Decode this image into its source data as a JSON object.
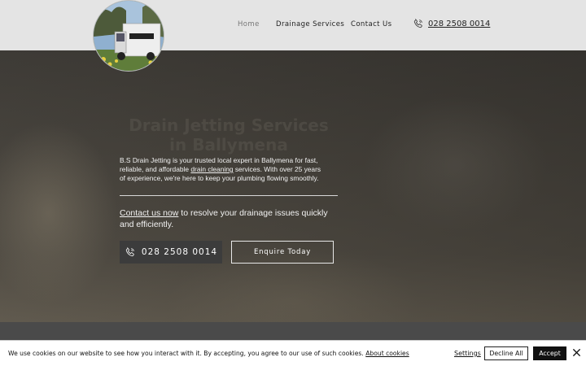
{
  "header": {
    "logo_alt": "B.S Drain Jetting van",
    "nav": [
      {
        "label": "Home",
        "active": true
      },
      {
        "label": "Drainage Services",
        "active": false
      },
      {
        "label": "Contact Us",
        "active": false
      }
    ],
    "phone": "028 2508 0014",
    "phone_icon": "phone-icon"
  },
  "hero": {
    "title": "Drain Jetting Services\nin Ballymena",
    "description_before": "B.S Drain Jetting is your trusted local expert in Ballymena for fast, reliable, and affordable ",
    "description_link": "drain cleaning",
    "description_after": " services. With over 25 years of experience, we're here to keep your plumbing flowing smoothly.",
    "cta_link": "Contact us now",
    "cta_text": " to resolve your drainage issues quickly and efficiently.",
    "phone_button": "028 2508 0014",
    "enquire_button": "Enquire Today"
  },
  "cookie": {
    "text": "We use cookies on our website to see how you interact with it. By accepting, you agree to our use of such cookies. ",
    "about_link": "About cookies",
    "settings": "Settings",
    "decline": "Decline All",
    "accept": "Accept",
    "close_icon": "close-icon"
  },
  "colors": {
    "header_bg": "#e4e4e4",
    "button_dark": "#3c3c3c",
    "accept_bg": "#111111"
  }
}
